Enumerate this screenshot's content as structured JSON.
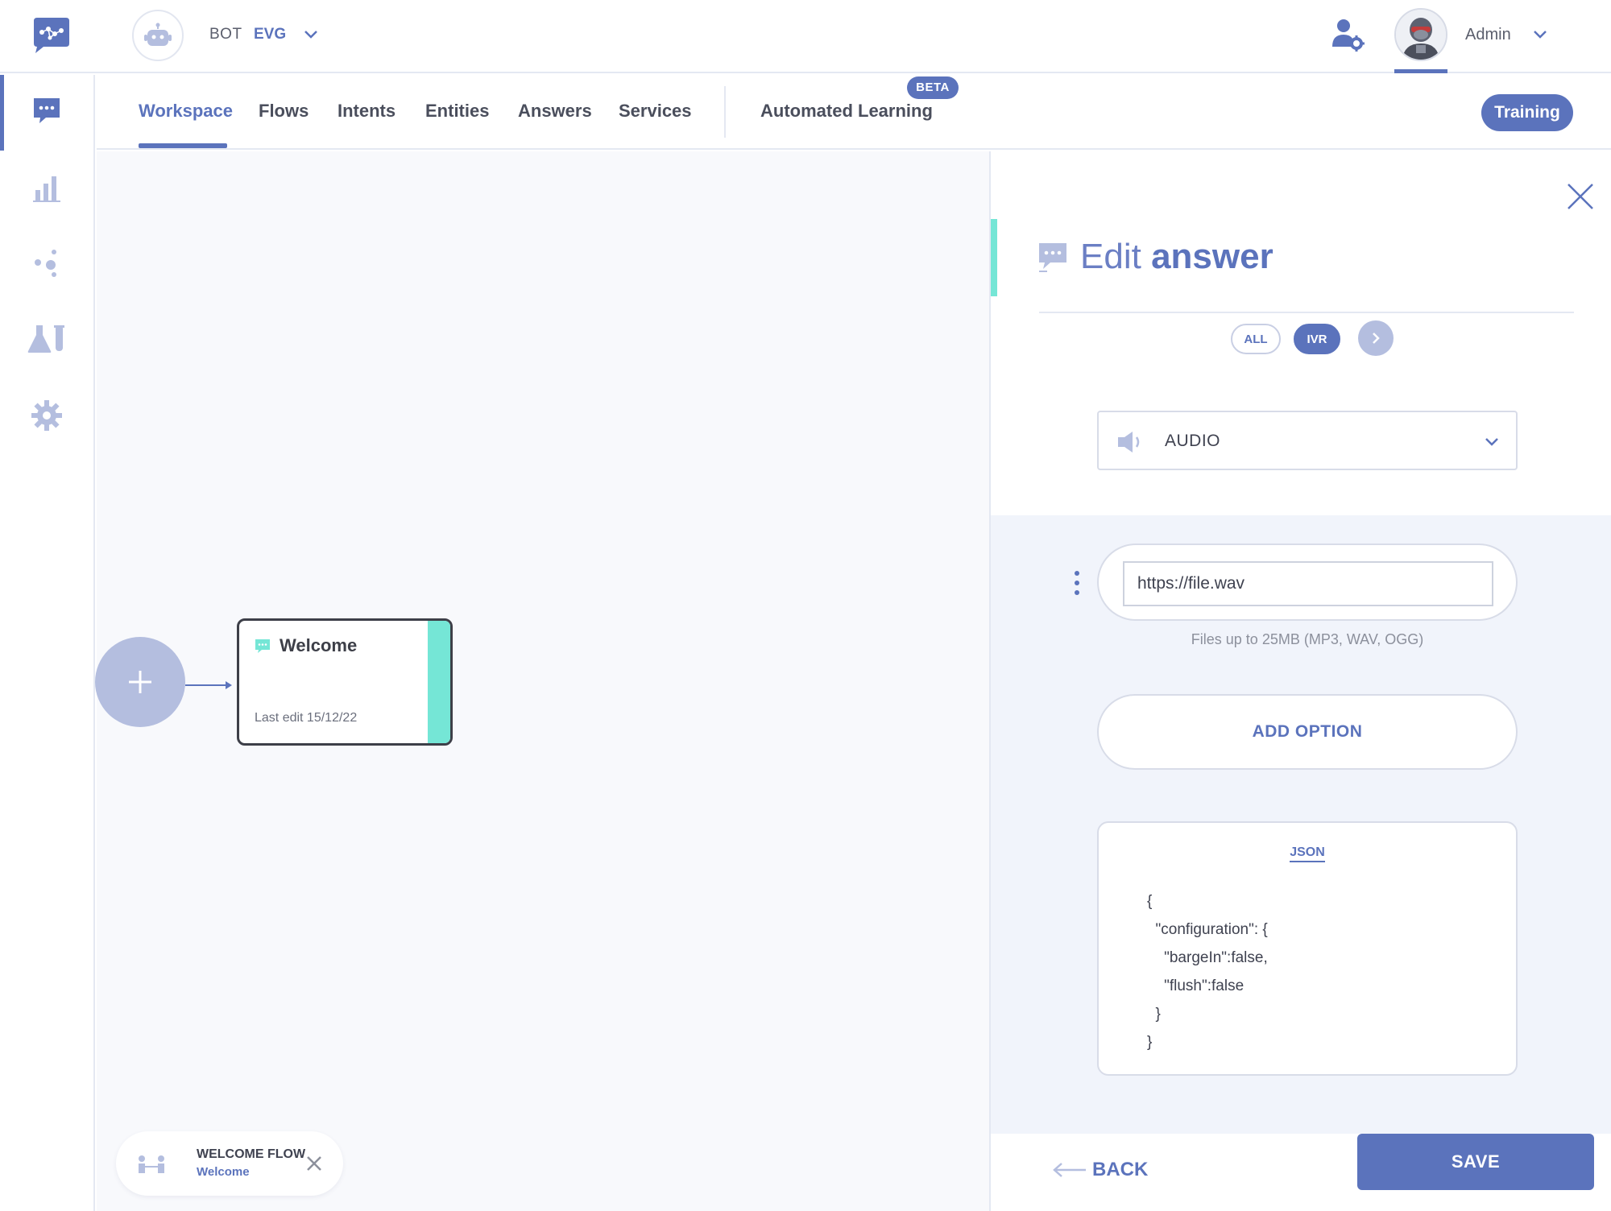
{
  "topbar": {
    "bot_label": "BOT",
    "bot_name": "EVG",
    "user_name": "Admin"
  },
  "nav": {
    "tabs": [
      {
        "label": "Workspace",
        "active": true
      },
      {
        "label": "Flows"
      },
      {
        "label": "Intents"
      },
      {
        "label": "Entities"
      },
      {
        "label": "Answers"
      },
      {
        "label": "Services"
      },
      {
        "label": "Automated Learning"
      }
    ],
    "beta_badge": "BETA",
    "training_label": "Training"
  },
  "sidebar": {
    "items": [
      {
        "icon": "chat-icon",
        "active": true
      },
      {
        "icon": "bar-chart-icon"
      },
      {
        "icon": "network-icon"
      },
      {
        "icon": "lab-flask-icon"
      },
      {
        "icon": "gear-icon"
      }
    ]
  },
  "canvas": {
    "node": {
      "title": "Welcome",
      "last_edit": "Last edit 15/12/22"
    },
    "flow_chip": {
      "title": "WELCOME FLOW",
      "subtitle": "Welcome"
    }
  },
  "panel": {
    "title_prefix": "Edit",
    "title_bold": "answer",
    "filters": [
      "ALL",
      "IVR"
    ],
    "active_filter": "IVR",
    "type_select": "AUDIO",
    "url_value": "https://file.wav",
    "url_hint": "Files up to 25MB (MP3, WAV, OGG)",
    "add_option_label": "ADD OPTION",
    "json_label": "JSON",
    "json_code": "{\n  \"configuration\": {\n    \"bargeIn\":false,\n    \"flush\":false\n  }\n}",
    "back_label": "BACK",
    "save_label": "SAVE"
  },
  "colors": {
    "accent": "#5b73bc",
    "teal": "#75e6d6",
    "muted_circle": "#b4bedf"
  }
}
